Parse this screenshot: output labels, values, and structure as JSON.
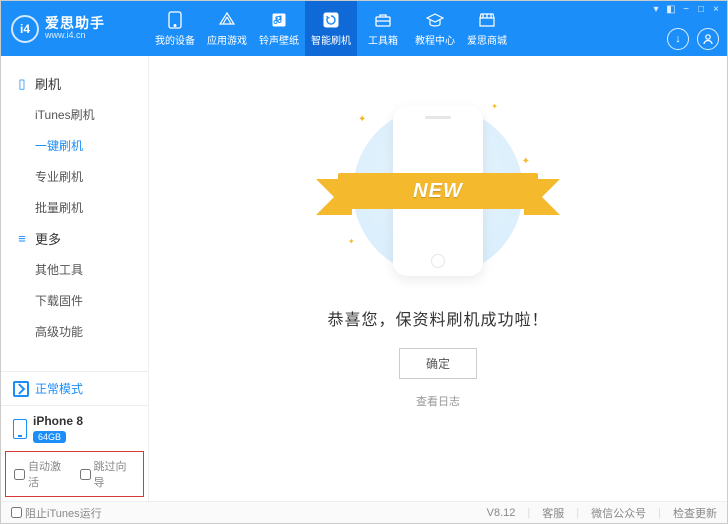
{
  "brand": {
    "name": "爱思助手",
    "url": "www.i4.cn",
    "logo_text": "i4"
  },
  "nav": {
    "items": [
      {
        "label": "我的设备"
      },
      {
        "label": "应用游戏"
      },
      {
        "label": "铃声壁纸"
      },
      {
        "label": "智能刷机"
      },
      {
        "label": "工具箱"
      },
      {
        "label": "教程中心"
      },
      {
        "label": "爱思商城"
      }
    ],
    "active_index": 3
  },
  "sidebar": {
    "sections": [
      {
        "title": "刷机",
        "items": [
          "iTunes刷机",
          "一键刷机",
          "专业刷机",
          "批量刷机"
        ],
        "active_index": 1
      },
      {
        "title": "更多",
        "items": [
          "其他工具",
          "下载固件",
          "高级功能"
        ],
        "active_index": -1
      }
    ],
    "mode": "正常模式",
    "device": {
      "name": "iPhone 8",
      "storage": "64GB"
    },
    "options": {
      "auto_activate": "自动激活",
      "skip_wizard": "跳过向导"
    }
  },
  "main": {
    "ribbon": "NEW",
    "success_text": "恭喜您，保资料刷机成功啦！",
    "ok_button": "确定",
    "view_log": "查看日志"
  },
  "footer": {
    "block_itunes": "阻止iTunes运行",
    "version": "V8.12",
    "links": [
      "客服",
      "微信公众号",
      "检查更新"
    ]
  }
}
